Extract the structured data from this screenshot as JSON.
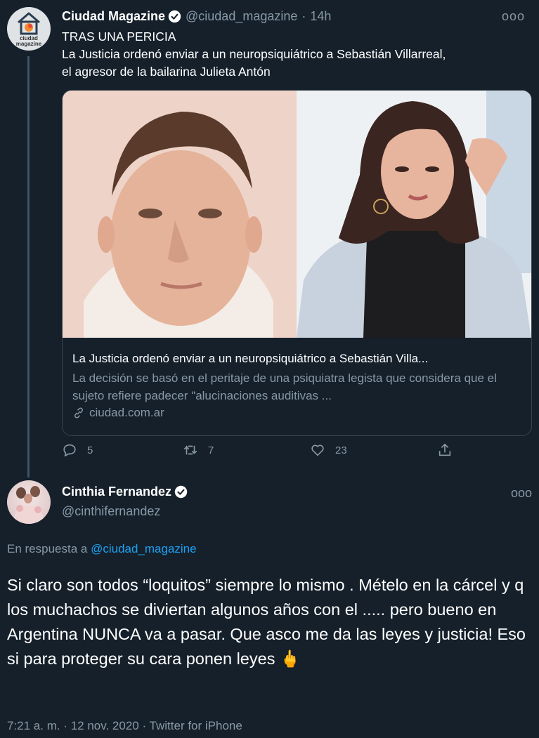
{
  "tweet1": {
    "avatar_label": "ciudad magazine",
    "name": "Ciudad Magazine",
    "handle": "@ciudad_magazine",
    "separator": "·",
    "time": "14h",
    "more": "ooo",
    "text_line1": "TRAS UNA PERICIA",
    "text_line2": "La Justicia ordenó enviar a un neuropsiquiátrico a Sebastián Villarreal,",
    "text_line3": "el agresor de la bailarina Julieta Antón",
    "card": {
      "title": "La Justicia ordenó enviar a un neuropsiquiátrico a Sebastián Villa...",
      "description": "La decisión se basó en el peritaje de una psiquiatra legista que considera que el sujeto refiere padecer \"alucinaciones auditivas ...",
      "link": "ciudad.com.ar"
    },
    "actions": {
      "reply_count": "5",
      "retweet_count": "7",
      "like_count": "23"
    }
  },
  "tweet2": {
    "name": "Cinthia Fernandez",
    "handle": "@cinthifernandez",
    "more": "ooo",
    "reply_prefix": "En respuesta a ",
    "reply_handle": "@ciudad_magazine",
    "body": "Si claro son todos “loquitos” siempre lo mismo . Mételo en la cárcel y q los muchachos se diviertan algunos años con el ..... pero bueno en Argentina NUNCA va a pasar. Que asco me da las leyes y justicia! Eso si para proteger su cara ponen leyes",
    "emoji": "🖕",
    "meta": "7:21 a. m. · 12 nov. 2020 · Twitter for iPhone"
  },
  "colors": {
    "background": "#15202b",
    "secondary_text": "#8899a6",
    "link": "#1da1f2",
    "border": "#38444d"
  }
}
